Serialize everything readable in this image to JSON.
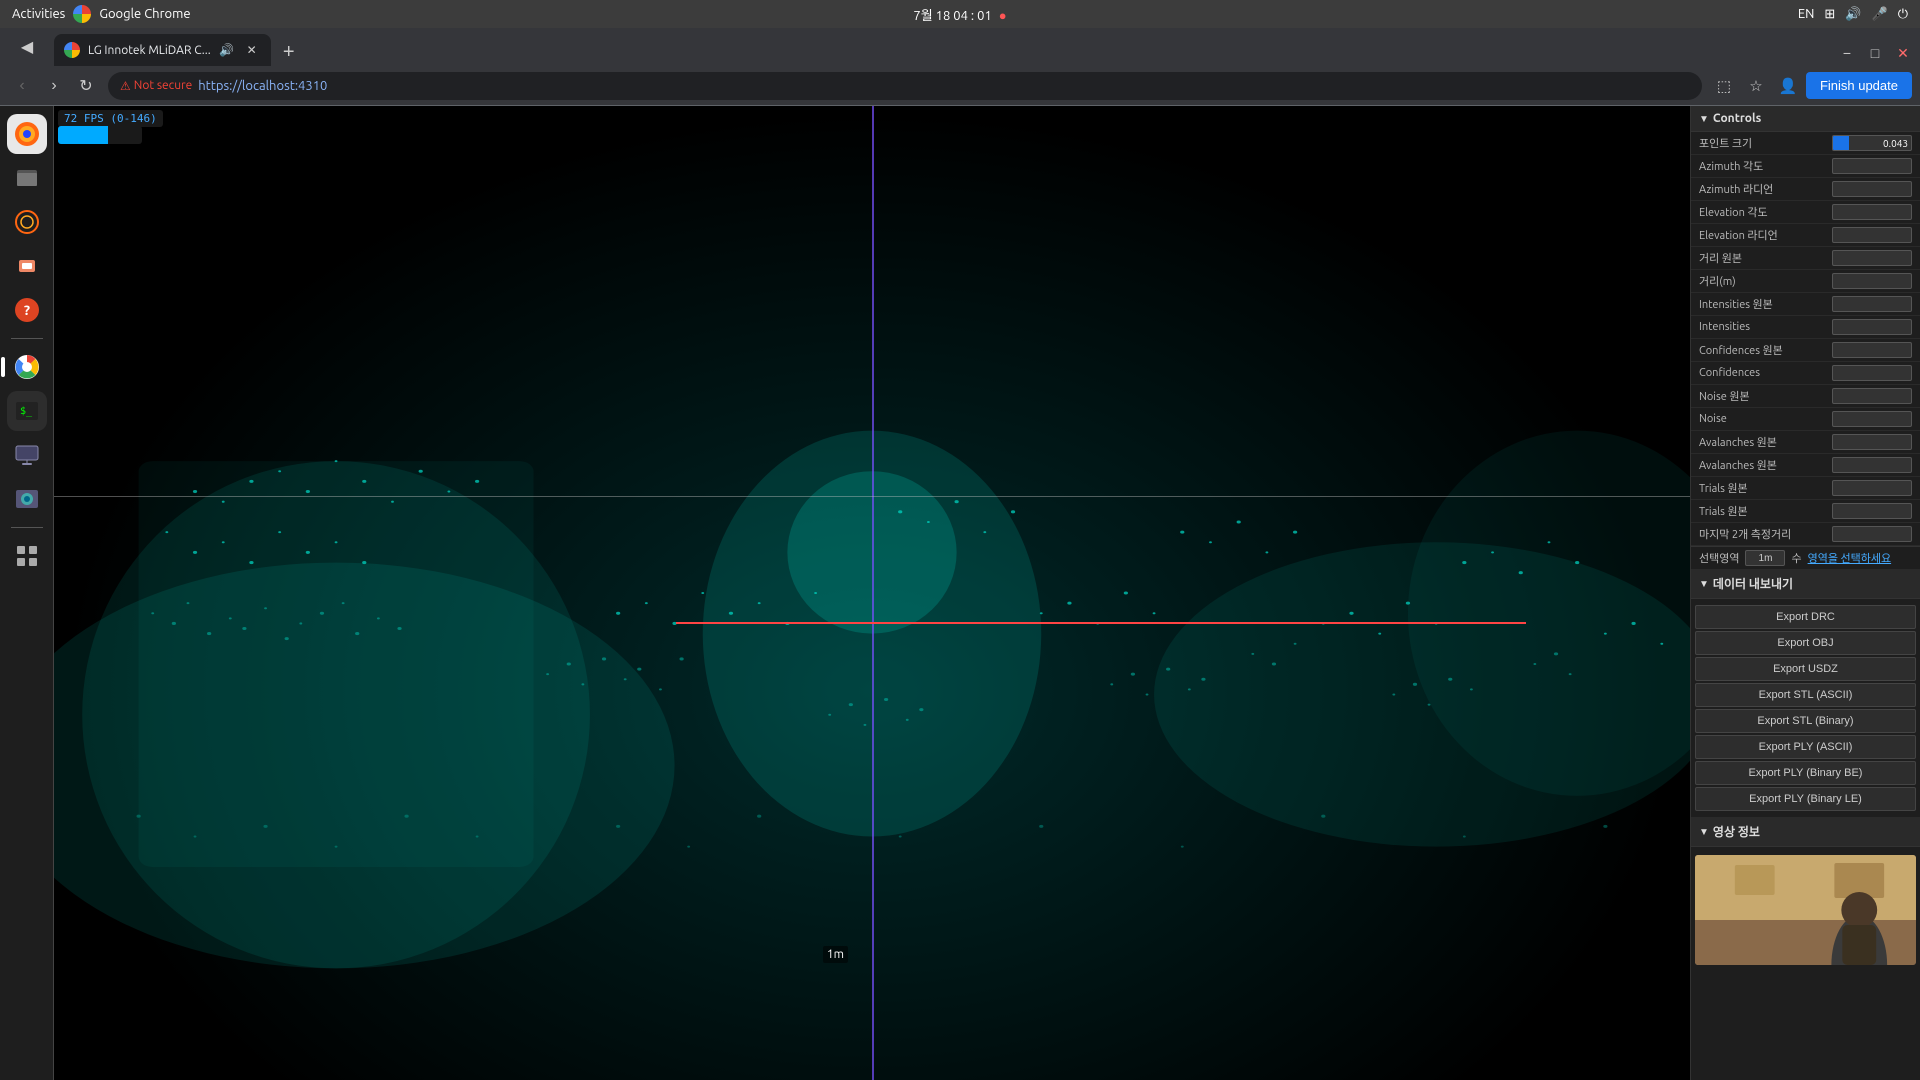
{
  "os": {
    "topbar": {
      "activities": "Activities",
      "chrome_label": "Google Chrome",
      "datetime": "7월 18  04 : 01",
      "record_dot": "●",
      "language": "EN",
      "network_icon": "network-icon",
      "sound_icon": "sound-icon",
      "mic_icon": "mic-icon",
      "power_icon": "power-icon"
    }
  },
  "browser": {
    "tab": {
      "label": "LG Innotek MLiDAR C...",
      "audio_icon": "audio-icon"
    },
    "address": {
      "not_secure": "Not secure",
      "url": "https://localhost:4310"
    },
    "finish_update": "Finish update",
    "wm_buttons": {
      "minimize": "−",
      "maximize": "□",
      "close": "✕"
    }
  },
  "fps": {
    "label": "72 FPS (0-146)"
  },
  "controls": {
    "title": "Controls",
    "rows": [
      {
        "label": "포인트 크기",
        "has_slider": true,
        "value": "0.043"
      },
      {
        "label": "Azimuth 각도",
        "has_slider": false,
        "value": ""
      },
      {
        "label": "Azimuth 라디언",
        "has_slider": false,
        "value": ""
      },
      {
        "label": "Elevation 각도",
        "has_slider": false,
        "value": ""
      },
      {
        "label": "Elevation 라디언",
        "has_slider": false,
        "value": ""
      },
      {
        "label": "거리 원본",
        "has_slider": false,
        "value": ""
      },
      {
        "label": "거리(m)",
        "has_slider": false,
        "value": ""
      },
      {
        "label": "Intensities 원본",
        "has_slider": false,
        "value": ""
      },
      {
        "label": "Intensities",
        "has_slider": false,
        "value": ""
      },
      {
        "label": "Confidences 원본",
        "has_slider": false,
        "value": ""
      },
      {
        "label": "Confidences",
        "has_slider": false,
        "value": ""
      },
      {
        "label": "Noise 원본",
        "has_slider": false,
        "value": ""
      },
      {
        "label": "Noise",
        "has_slider": false,
        "value": ""
      },
      {
        "label": "Avalanches 원본",
        "has_slider": false,
        "value": ""
      },
      {
        "label": "Avalanches 원본",
        "has_slider": false,
        "value": ""
      },
      {
        "label": "Trials 원본",
        "has_slider": false,
        "value": ""
      },
      {
        "label": "Trials 원본",
        "has_slider": false,
        "value": ""
      },
      {
        "label": "마지막 2개 측정거리",
        "has_slider": false,
        "value": ""
      }
    ],
    "selection_label": "선택영역",
    "selection_value": "1m",
    "selection_suffix": "수",
    "selection_link": "영역을 선택하세요",
    "export_section": "데이터 내보내기",
    "export_buttons": [
      "Export DRC",
      "Export OBJ",
      "Export USDZ",
      "Export STL (ASCII)",
      "Export STL (Binary)",
      "Export PLY (ASCII)",
      "Export PLY (Binary BE)",
      "Export PLY (Binary LE)"
    ],
    "video_section": "영상 정보"
  },
  "viewer": {
    "measure_label": "1m"
  }
}
